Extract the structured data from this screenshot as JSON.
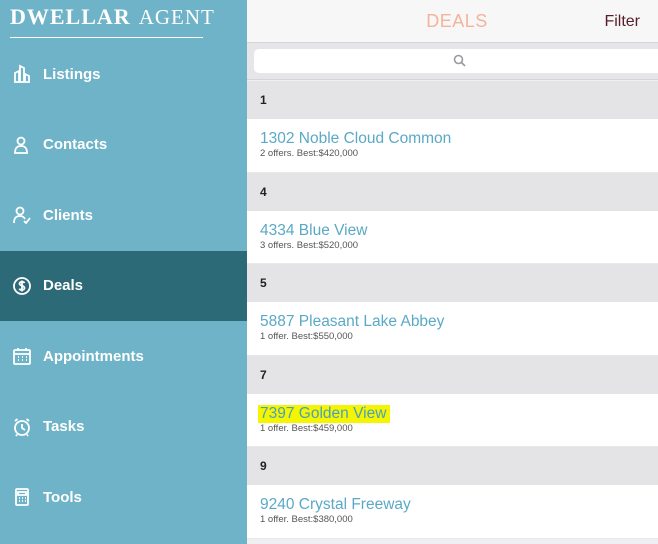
{
  "brand": {
    "main": "DWELLAR",
    "sub": "AGENT"
  },
  "sidebar": {
    "items": [
      {
        "label": "Listings",
        "icon": "buildings-icon",
        "active": false
      },
      {
        "label": "Contacts",
        "icon": "person-icon",
        "active": false
      },
      {
        "label": "Clients",
        "icon": "person-check-icon",
        "active": false
      },
      {
        "label": "Deals",
        "icon": "dollar-coin-icon",
        "active": true
      },
      {
        "label": "Appointments",
        "icon": "calendar-icon",
        "active": false
      },
      {
        "label": "Tasks",
        "icon": "alarm-clock-icon",
        "active": false
      },
      {
        "label": "Tools",
        "icon": "calculator-icon",
        "active": false
      }
    ],
    "colors": {
      "background": "#6fb3c8",
      "active": "#2d6a78"
    }
  },
  "header": {
    "title": "DEALS",
    "filter_label": "Filter"
  },
  "search": {
    "placeholder": ""
  },
  "sections": [
    {
      "header": "1",
      "address": "1302 Noble Cloud Common",
      "summary": "2 offers. Best:$420,000"
    },
    {
      "header": "4",
      "address": "4334 Blue View",
      "summary": "3 offers. Best:$520,000"
    },
    {
      "header": "5",
      "address": "5887 Pleasant Lake Abbey",
      "summary": "1 offer. Best:$550,000"
    },
    {
      "header": "7",
      "address": "7397 Golden View",
      "summary": "1 offer. Best:$459,000",
      "highlighted": true
    },
    {
      "header": "9",
      "address": "9240 Crystal Freeway",
      "summary": "1 offer. Best:$380,000"
    }
  ]
}
